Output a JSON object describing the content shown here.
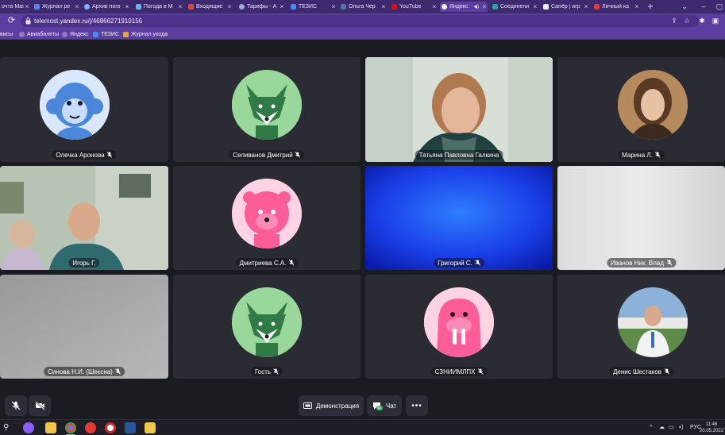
{
  "browser": {
    "tabs": [
      {
        "title": "очта Mail",
        "color": "#f0a71e"
      },
      {
        "title": "Журнал ре",
        "color": "#4c8bf5"
      },
      {
        "title": "Архив пого",
        "color": "#7fb2ff"
      },
      {
        "title": "Погода в М",
        "color": "#64b5f6"
      },
      {
        "title": "Входящие",
        "color": "#ea4335"
      },
      {
        "title": "Тарифы - А",
        "color": "#9fa8da"
      },
      {
        "title": "ТЕЗИС",
        "color": "#4c8bf5"
      },
      {
        "title": "Ольга Чер",
        "color": "#4a76a8"
      },
      {
        "title": "YouTube",
        "color": "#ff0000"
      },
      {
        "title": "Яндекс",
        "color": "#f2f2f2",
        "active": true
      },
      {
        "title": "Соединени",
        "color": "#26a69a"
      },
      {
        "title": "Сапёр | игр",
        "color": "#eeeeee"
      },
      {
        "title": "Личный ка",
        "color": "#e53935"
      }
    ],
    "url": "telemost.yandex.ru/j/46866271910156",
    "bookmarks": [
      {
        "label": "висы",
        "color": "#b388ff"
      },
      {
        "label": "Авиабилеты",
        "color": "#8e7cc3"
      },
      {
        "label": "Яндекс",
        "color": "#8e7cc3"
      },
      {
        "label": "ТЕЗИС",
        "color": "#4c8bf5"
      },
      {
        "label": "Журнал ухода",
        "color": "#e8a33d"
      }
    ]
  },
  "participants": [
    {
      "name": "Олечка Аронова",
      "type": "avatar",
      "animal": "monkey",
      "bg": "#d9e8ff",
      "speaking": false
    },
    {
      "name": "Селиванов Дмитрий",
      "type": "avatar",
      "animal": "fox",
      "bg": "#9ad79a",
      "speaking": false
    },
    {
      "name": "Татьяна Павловна Галкина",
      "type": "video",
      "speaking": true
    },
    {
      "name": "Марина Л.",
      "type": "photo",
      "speaking": false
    },
    {
      "name": "Игорь Г.",
      "type": "video",
      "speaking": false
    },
    {
      "name": "Дмитриева С.А.",
      "type": "avatar",
      "animal": "lion",
      "bg": "#ffd3e4",
      "speaking": false
    },
    {
      "name": "Григорий С.",
      "type": "video",
      "speaking": false
    },
    {
      "name": "Иванов Ник. Влад",
      "type": "video",
      "speaking": false
    },
    {
      "name": "Синова Н.И. (Шексна)",
      "type": "video",
      "speaking": false
    },
    {
      "name": "Гость",
      "type": "avatar",
      "animal": "fox",
      "bg": "#9ad79a",
      "speaking": false
    },
    {
      "name": "СЗНИИМЛПХ",
      "type": "avatar",
      "animal": "walrus",
      "bg": "#ffd3e4",
      "speaking": false
    },
    {
      "name": "Денис Шестаков",
      "type": "photo",
      "speaking": false
    }
  ],
  "controls": {
    "demo_label": "Демонстрация",
    "chat_label": "Чат",
    "chat_badge": "11"
  },
  "taskbar": {
    "language": "РУС",
    "time": "11:46",
    "date": "20.05.2022"
  },
  "colors": {
    "accent_purple": "#5b3fa0",
    "speaking_border": "#f2d33c",
    "tile_bg": "#2a2b33"
  }
}
